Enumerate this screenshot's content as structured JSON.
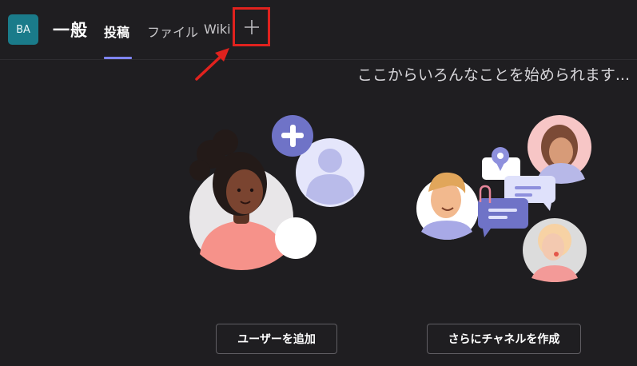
{
  "header": {
    "avatar_initials": "BA",
    "channel_title": "一般",
    "tabs": [
      {
        "label": "投稿",
        "active": true
      },
      {
        "label": "ファイル",
        "active": false
      },
      {
        "label": "Wiki",
        "active": false
      }
    ],
    "add_tab_icon": "plus-icon",
    "annotation_color": "#e0221e"
  },
  "main": {
    "hint_text": "ここからいろんなことを始められます...",
    "actions": {
      "add_user_label": "ユーザーを追加",
      "more_channels_label": "さらにチャネルを作成"
    }
  },
  "colors": {
    "background": "#1f1e21",
    "accent": "#7f85f5",
    "avatar": "#1a7b8a"
  }
}
